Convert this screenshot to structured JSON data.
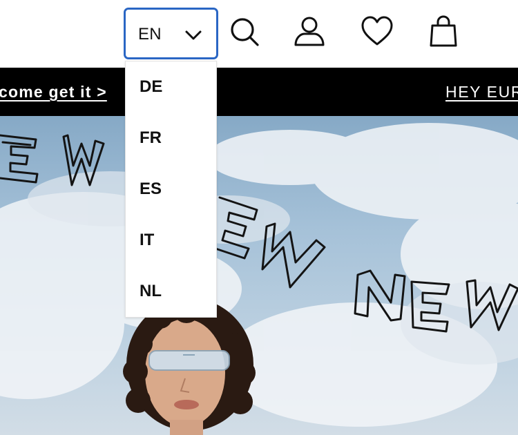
{
  "header": {
    "language": {
      "selected": "EN",
      "options": [
        "DE",
        "FR",
        "ES",
        "IT",
        "NL"
      ]
    },
    "icons": [
      "search-icon",
      "account-icon",
      "wishlist-icon",
      "cart-icon"
    ]
  },
  "promo_bar": {
    "link_text": "come get it >",
    "next_text": "HEY EUR"
  },
  "hero": {
    "art_text": [
      "EW",
      "EW",
      "NEW"
    ]
  },
  "colors": {
    "accent": "#2a66c4",
    "promo_bg": "#000000",
    "text": "#111111"
  }
}
